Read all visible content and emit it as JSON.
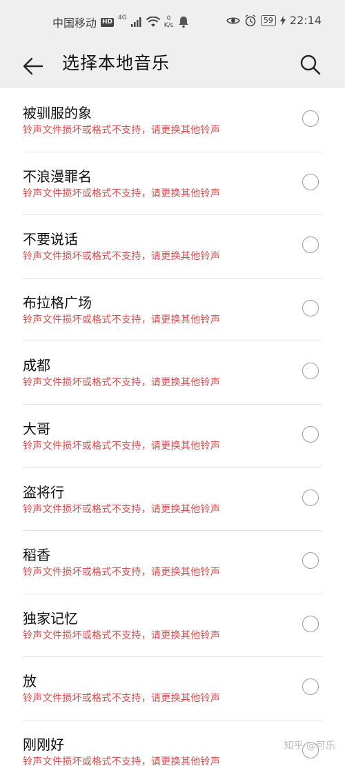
{
  "status_bar": {
    "carrier": "中国移动",
    "hd": "HD",
    "network": "4G",
    "speed_value": "0",
    "speed_unit": "K/s",
    "battery": "59",
    "time": "22:14"
  },
  "header": {
    "title": "选择本地音乐"
  },
  "songs": [
    {
      "name": "被驯服的象",
      "error": "铃声文件损坏或格式不支持，请更换其他铃声"
    },
    {
      "name": "不浪漫罪名",
      "error": "铃声文件损坏或格式不支持，请更换其他铃声"
    },
    {
      "name": "不要说话",
      "error": "铃声文件损坏或格式不支持，请更换其他铃声"
    },
    {
      "name": "布拉格广场",
      "error": "铃声文件损坏或格式不支持，请更换其他铃声"
    },
    {
      "name": "成都",
      "error": "铃声文件损坏或格式不支持，请更换其他铃声"
    },
    {
      "name": "大哥",
      "error": "铃声文件损坏或格式不支持，请更换其他铃声"
    },
    {
      "name": "盗将行",
      "error": "铃声文件损坏或格式不支持，请更换其他铃声"
    },
    {
      "name": "稻香",
      "error": "铃声文件损坏或格式不支持，请更换其他铃声"
    },
    {
      "name": "独家记忆",
      "error": "铃声文件损坏或格式不支持，请更换其他铃声"
    },
    {
      "name": "放",
      "error": "铃声文件损坏或格式不支持，请更换其他铃声"
    },
    {
      "name": "刚刚好",
      "error": "铃声文件损坏或格式不支持，请更换其他铃声"
    }
  ],
  "watermark": "知乎 @可乐",
  "colors": {
    "error_text": "#d44c4c",
    "header_bg": "#efefef"
  }
}
